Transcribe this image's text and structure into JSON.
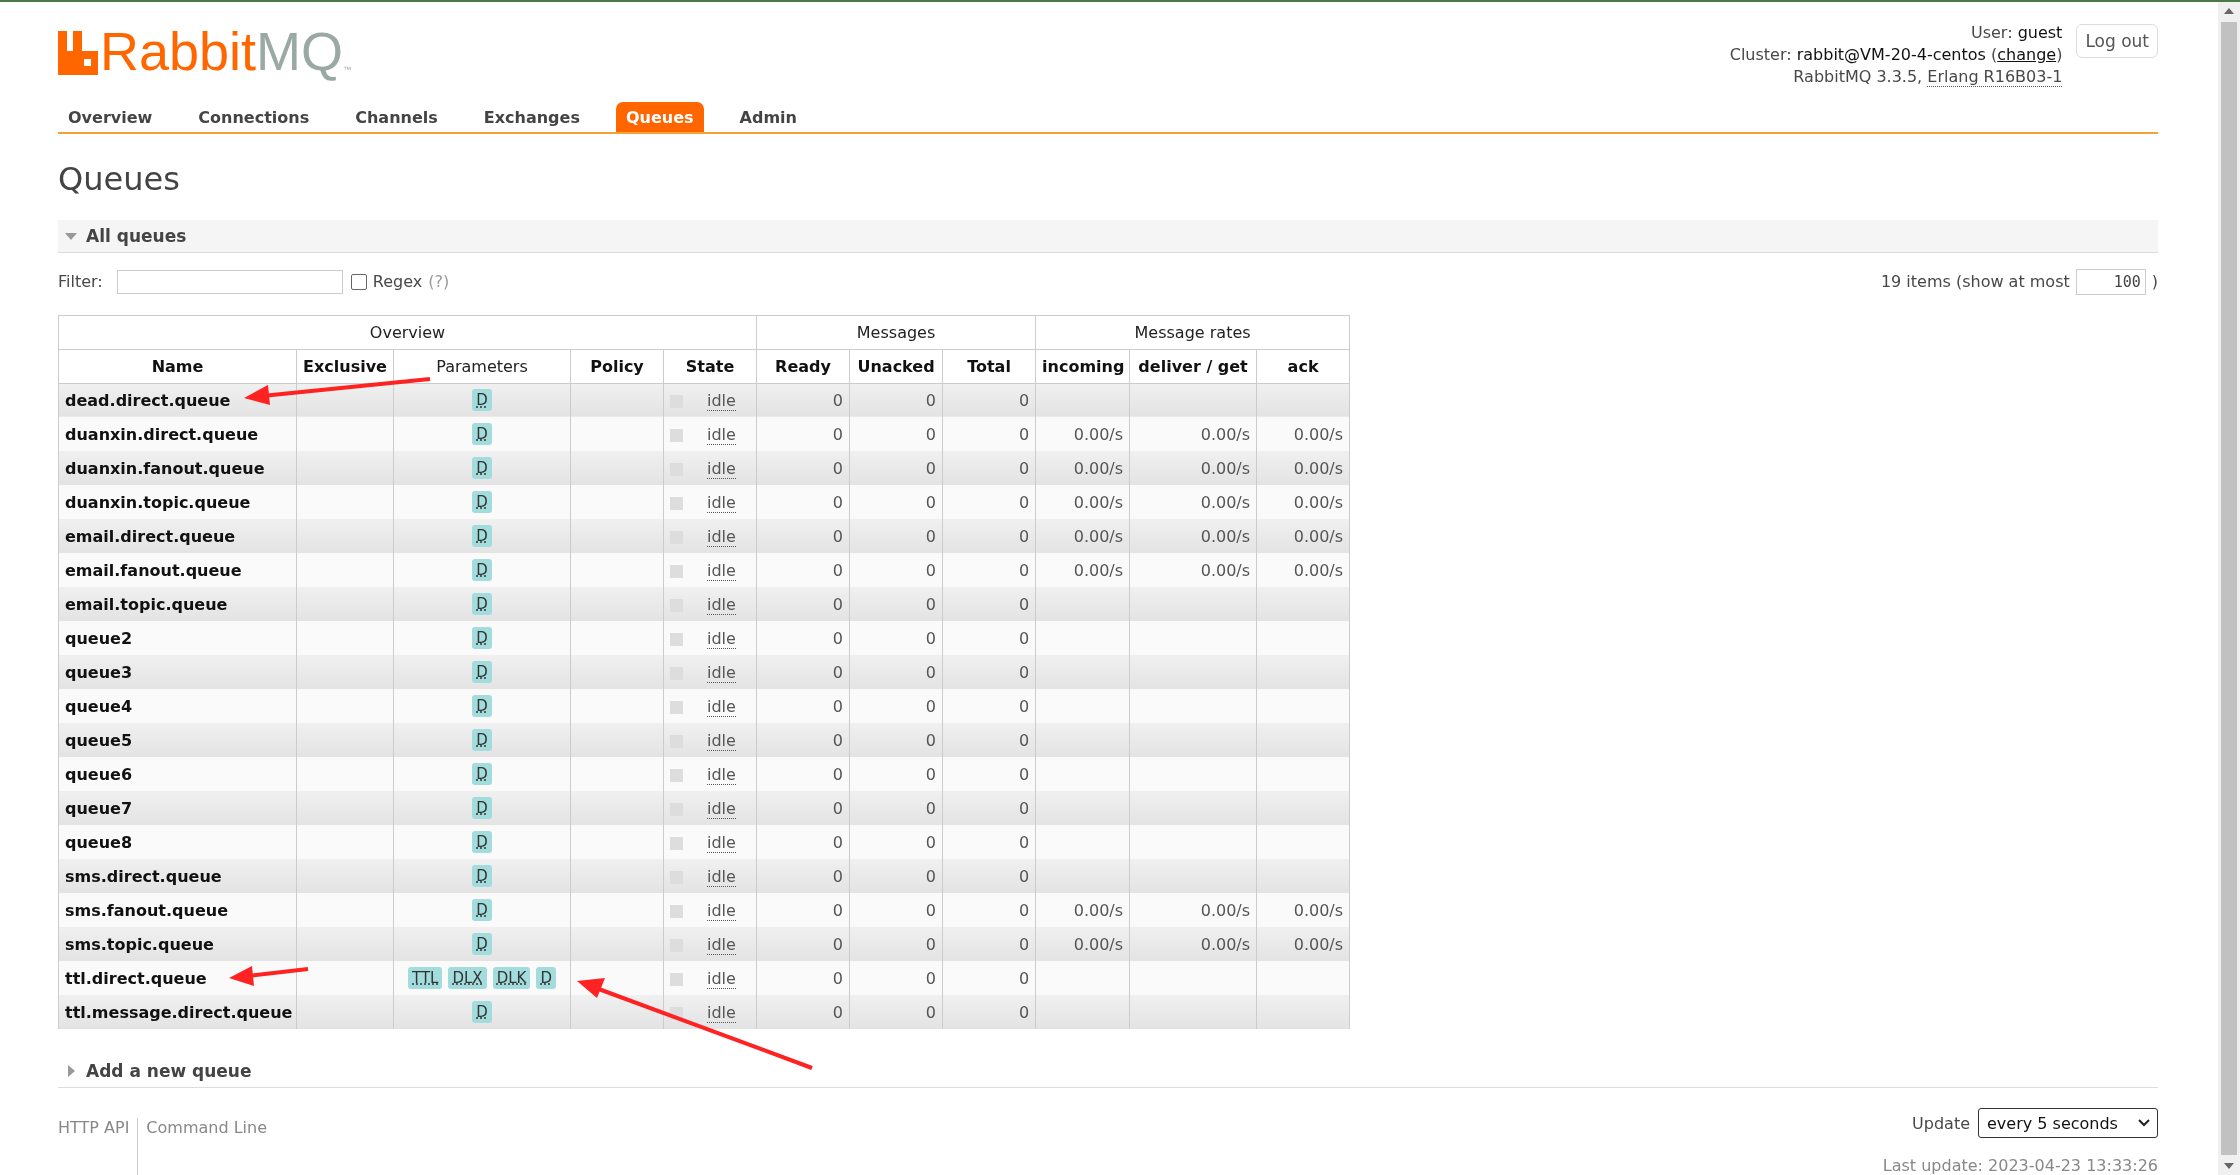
{
  "logo": {
    "brand": "Rabbit",
    "product": "MQ",
    "tm": "™"
  },
  "header": {
    "user_label": "User:",
    "user": "guest",
    "cluster_label": "Cluster:",
    "cluster": "rabbit@VM-20-4-centos",
    "change_open": "(",
    "change_link": "change",
    "change_close": ")",
    "version": "RabbitMQ 3.3.5,",
    "erlang": "Erlang R16B03-1",
    "logout": "Log out"
  },
  "tabs": [
    {
      "label": "Overview",
      "selected": false
    },
    {
      "label": "Connections",
      "selected": false
    },
    {
      "label": "Channels",
      "selected": false
    },
    {
      "label": "Exchanges",
      "selected": false
    },
    {
      "label": "Queues",
      "selected": true
    },
    {
      "label": "Admin",
      "selected": false
    }
  ],
  "page_title": "Queues",
  "section": {
    "title": "All queues",
    "expanded": true
  },
  "filter": {
    "label": "Filter:",
    "regex_label": "Regex",
    "regex_checked": false,
    "help": "(?)",
    "items_text": "19 items (show at most",
    "max_value": "100",
    "close": ")"
  },
  "table": {
    "groups": [
      {
        "label": "Overview"
      },
      {
        "label": "Messages"
      },
      {
        "label": "Message rates"
      }
    ],
    "columns": [
      {
        "label": "Name"
      },
      {
        "label": "Exclusive"
      },
      {
        "label": "Parameters"
      },
      {
        "label": "Policy"
      },
      {
        "label": "State"
      },
      {
        "label": "Ready"
      },
      {
        "label": "Unacked"
      },
      {
        "label": "Total"
      },
      {
        "label": "incoming"
      },
      {
        "label": "deliver / get"
      },
      {
        "label": "ack"
      }
    ],
    "rows": [
      {
        "name": "dead.direct.queue",
        "parameters": [
          "D"
        ],
        "state": "idle",
        "ready": "0",
        "unacked": "0",
        "total": "0"
      },
      {
        "name": "duanxin.direct.queue",
        "parameters": [
          "D"
        ],
        "state": "idle",
        "ready": "0",
        "unacked": "0",
        "total": "0",
        "incoming": "0.00/s",
        "deliver_get": "0.00/s",
        "ack": "0.00/s"
      },
      {
        "name": "duanxin.fanout.queue",
        "parameters": [
          "D"
        ],
        "state": "idle",
        "ready": "0",
        "unacked": "0",
        "total": "0",
        "incoming": "0.00/s",
        "deliver_get": "0.00/s",
        "ack": "0.00/s"
      },
      {
        "name": "duanxin.topic.queue",
        "parameters": [
          "D"
        ],
        "state": "idle",
        "ready": "0",
        "unacked": "0",
        "total": "0",
        "incoming": "0.00/s",
        "deliver_get": "0.00/s",
        "ack": "0.00/s"
      },
      {
        "name": "email.direct.queue",
        "parameters": [
          "D"
        ],
        "state": "idle",
        "ready": "0",
        "unacked": "0",
        "total": "0",
        "incoming": "0.00/s",
        "deliver_get": "0.00/s",
        "ack": "0.00/s"
      },
      {
        "name": "email.fanout.queue",
        "parameters": [
          "D"
        ],
        "state": "idle",
        "ready": "0",
        "unacked": "0",
        "total": "0",
        "incoming": "0.00/s",
        "deliver_get": "0.00/s",
        "ack": "0.00/s"
      },
      {
        "name": "email.topic.queue",
        "parameters": [
          "D"
        ],
        "state": "idle",
        "ready": "0",
        "unacked": "0",
        "total": "0"
      },
      {
        "name": "queue2",
        "parameters": [
          "D"
        ],
        "state": "idle",
        "ready": "0",
        "unacked": "0",
        "total": "0"
      },
      {
        "name": "queue3",
        "parameters": [
          "D"
        ],
        "state": "idle",
        "ready": "0",
        "unacked": "0",
        "total": "0"
      },
      {
        "name": "queue4",
        "parameters": [
          "D"
        ],
        "state": "idle",
        "ready": "0",
        "unacked": "0",
        "total": "0"
      },
      {
        "name": "queue5",
        "parameters": [
          "D"
        ],
        "state": "idle",
        "ready": "0",
        "unacked": "0",
        "total": "0"
      },
      {
        "name": "queue6",
        "parameters": [
          "D"
        ],
        "state": "idle",
        "ready": "0",
        "unacked": "0",
        "total": "0"
      },
      {
        "name": "queue7",
        "parameters": [
          "D"
        ],
        "state": "idle",
        "ready": "0",
        "unacked": "0",
        "total": "0"
      },
      {
        "name": "queue8",
        "parameters": [
          "D"
        ],
        "state": "idle",
        "ready": "0",
        "unacked": "0",
        "total": "0"
      },
      {
        "name": "sms.direct.queue",
        "parameters": [
          "D"
        ],
        "state": "idle",
        "ready": "0",
        "unacked": "0",
        "total": "0"
      },
      {
        "name": "sms.fanout.queue",
        "parameters": [
          "D"
        ],
        "state": "idle",
        "ready": "0",
        "unacked": "0",
        "total": "0",
        "incoming": "0.00/s",
        "deliver_get": "0.00/s",
        "ack": "0.00/s"
      },
      {
        "name": "sms.topic.queue",
        "parameters": [
          "D"
        ],
        "state": "idle",
        "ready": "0",
        "unacked": "0",
        "total": "0",
        "incoming": "0.00/s",
        "deliver_get": "0.00/s",
        "ack": "0.00/s"
      },
      {
        "name": "ttl.direct.queue",
        "parameters": [
          "TTL",
          "DLX",
          "DLK",
          "D"
        ],
        "state": "idle",
        "ready": "0",
        "unacked": "0",
        "total": "0"
      },
      {
        "name": "ttl.message.direct.queue",
        "parameters": [
          "D"
        ],
        "state": "idle",
        "ready": "0",
        "unacked": "0",
        "total": "0"
      }
    ]
  },
  "add_section": {
    "title": "Add a new queue",
    "expanded": false
  },
  "footer": {
    "links": [
      "HTTP API",
      "Command Line"
    ],
    "update_label": "Update",
    "update_value": "every 5 seconds",
    "last_update": "Last update: 2023-04-23 13:33:26"
  }
}
